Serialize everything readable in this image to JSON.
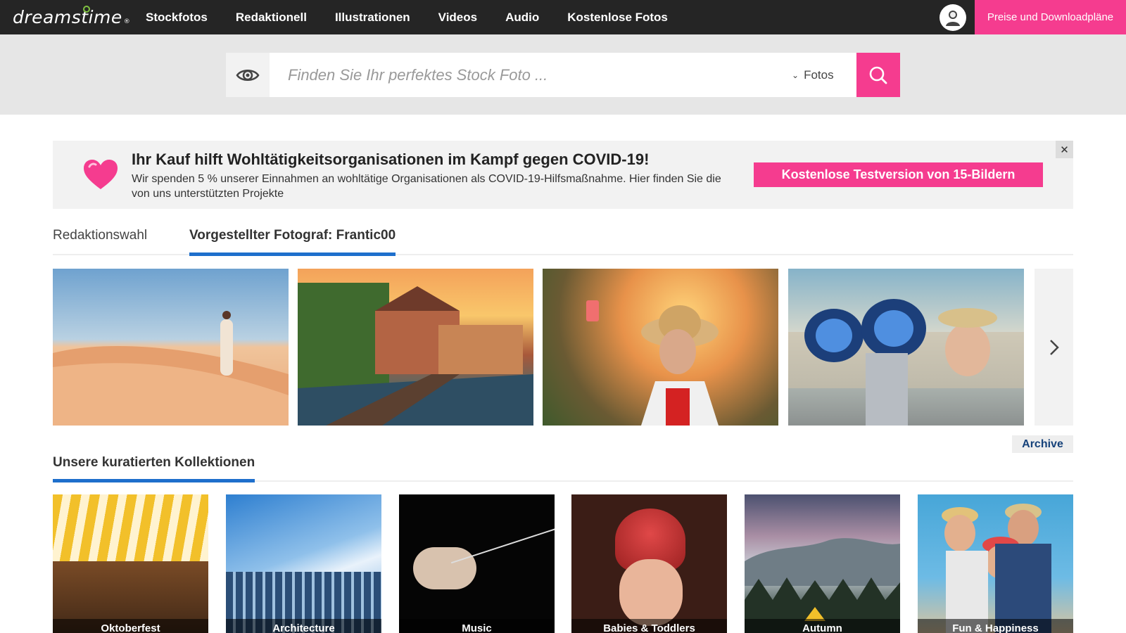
{
  "header": {
    "logo_text": "dreamstime",
    "logo_reg": "®",
    "nav": [
      "Stockfotos",
      "Redaktionell",
      "Illustrationen",
      "Videos",
      "Audio",
      "Kostenlose Fotos"
    ],
    "pricing_label": "Preise und Downloadpläne"
  },
  "search": {
    "placeholder": "Finden Sie Ihr perfektes Stock Foto ...",
    "type_selected": "Fotos"
  },
  "banner": {
    "title": "Ihr Kauf hilft Wohltätigkeitsorganisationen im Kampf gegen COVID-19!",
    "text": "Wir spenden 5 % unserer Einnahmen an wohltätige Organisationen als COVID-19-Hilfsmaßnahme. Hier finden Sie die von uns unterstützten Projekte",
    "cta": "Kostenlose Testversion von 15-Bildern",
    "close": "✕"
  },
  "tabs": {
    "editors_choice": "Redaktionswahl",
    "featured": "Vorgestellter Fotograf: Frantic00"
  },
  "featured_photos": [
    "woman-in-desert",
    "half-timbered-houses-at-sunset",
    "woman-taking-selfie",
    "woman-with-coin-binoculars"
  ],
  "archive_label": "Archive",
  "collections": {
    "title": "Unsere kuratierten Kollektionen",
    "items": [
      "Oktoberfest",
      "Architecture",
      "Music",
      "Babies & Toddlers",
      "Autumn",
      "Fun & Happiness"
    ]
  },
  "colors": {
    "brand_pink": "#f53c8f",
    "nav_bg": "#252525",
    "tab_accent": "#1e6fcc",
    "archive_text": "#16427a"
  }
}
